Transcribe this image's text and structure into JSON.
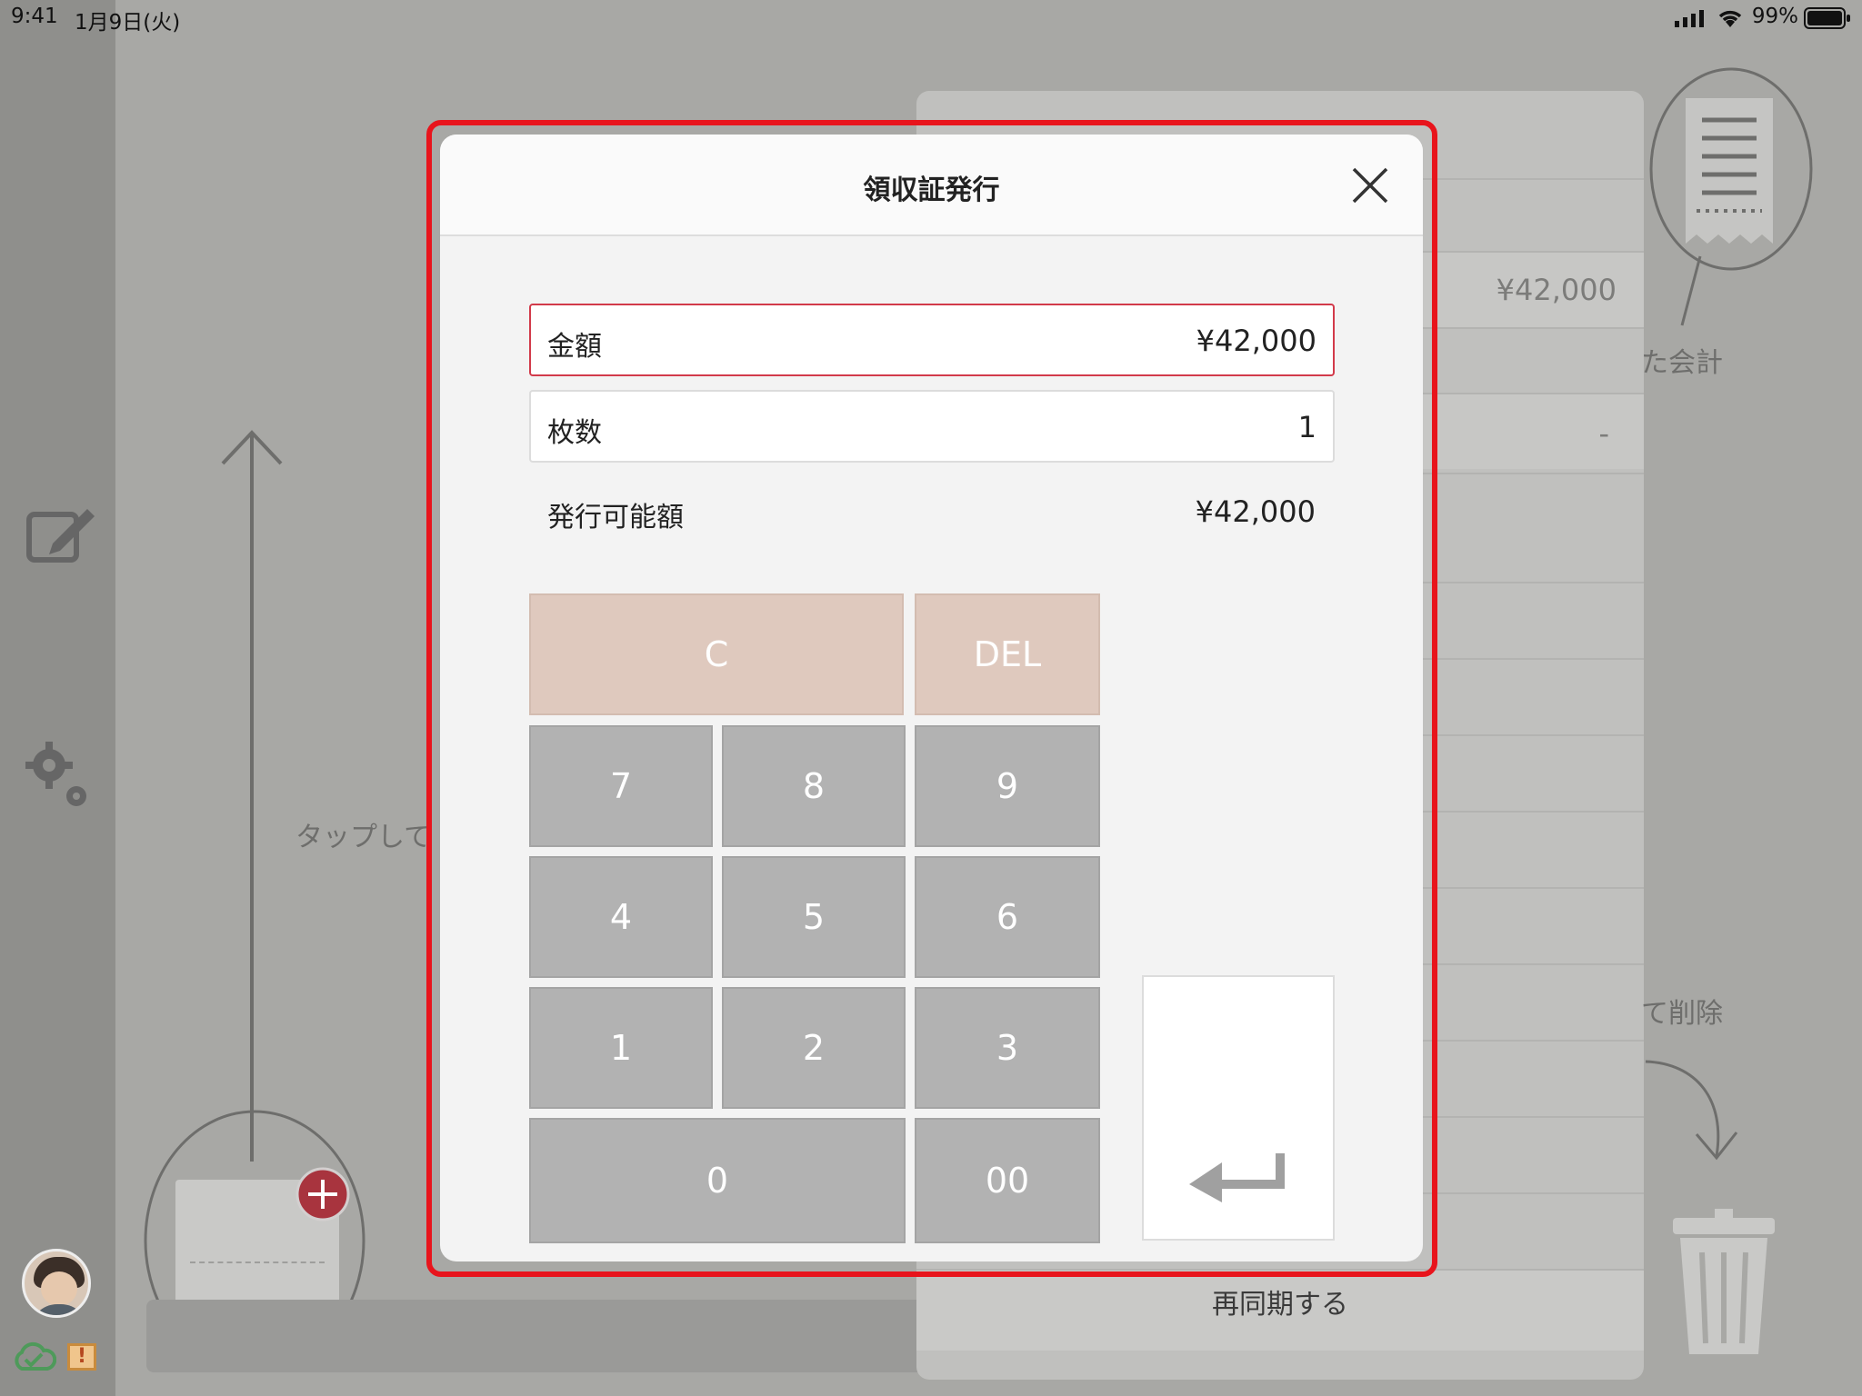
{
  "status_bar": {
    "time": "9:41",
    "date": "1月9日(火)",
    "battery": "99%"
  },
  "background": {
    "amount": "¥42,000",
    "dash": "-",
    "hint_sent": "た会計",
    "hint_delete": "て削除",
    "hint_tap": "タップして",
    "resync": "再同期する"
  },
  "modal": {
    "title": "領収証発行",
    "amount_field": {
      "label": "金額",
      "value": "¥42,000"
    },
    "count_field": {
      "label": "枚数",
      "value": "1"
    },
    "available": {
      "label": "発行可能額",
      "value": "¥42,000"
    },
    "keypad": {
      "clear": "C",
      "delete": "DEL",
      "k7": "7",
      "k8": "8",
      "k9": "9",
      "k4": "4",
      "k5": "5",
      "k6": "6",
      "k1": "1",
      "k2": "2",
      "k3": "3",
      "k0": "0",
      "k00": "00"
    }
  },
  "colors": {
    "highlight": "#e8141c",
    "active_border": "#d23a4a",
    "func_key": "#dfc9be",
    "num_key": "#b2b2b2"
  },
  "icons": [
    "edit-icon",
    "settings-icon",
    "avatar",
    "cloud-sync-icon",
    "warning-icon",
    "receipt-icon",
    "trash-icon",
    "close-icon",
    "enter-icon",
    "add-icon"
  ]
}
